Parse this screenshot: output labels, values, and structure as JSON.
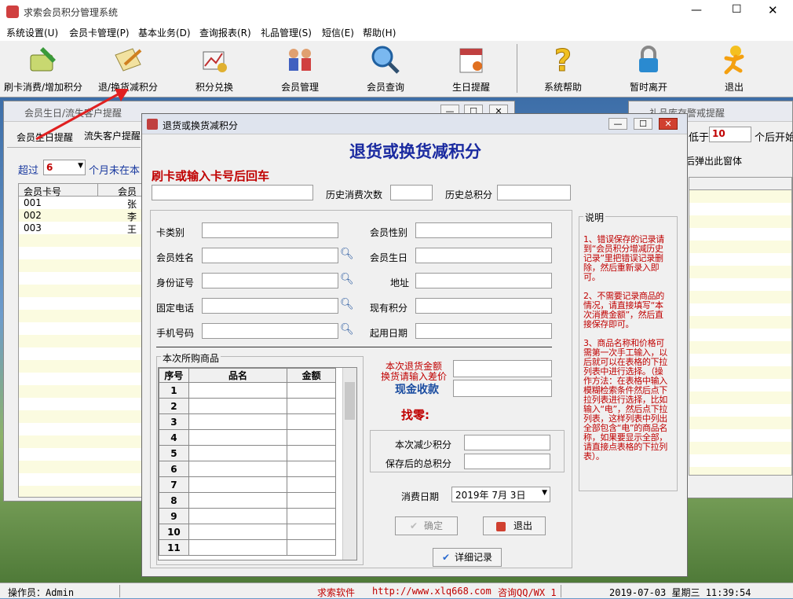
{
  "app": {
    "title": "求索会员积分管理系统",
    "window_controls": [
      "—",
      "☐",
      "✕"
    ]
  },
  "menu": [
    "系统设置(U)",
    "会员卡管理(P)",
    "基本业务(D)",
    "查询报表(R)",
    "礼品管理(S)",
    "短信(E)",
    "帮助(H)"
  ],
  "toolbar": [
    "刷卡消费/增加积分",
    "退/换货减积分",
    "积分兑换",
    "会员管理",
    "会员查询",
    "生日提醒",
    "系统帮助",
    "暂时离开",
    "退出"
  ],
  "birthday_win": {
    "title": "会员生日/流失客户提醒",
    "tabs": [
      "会员生日提醒",
      "流失客户提醒"
    ],
    "over_label": "超过",
    "months_value": "6",
    "months_text": "个月未在本",
    "columns": [
      "会员卡号",
      "会员姓"
    ],
    "rows": [
      {
        "card": "001",
        "name": "张三"
      },
      {
        "card": "002",
        "name": "李四"
      },
      {
        "card": "003",
        "name": "王五"
      }
    ]
  },
  "gift_win": {
    "title": "礼品库存警戒提醒",
    "below_text": "低于",
    "qty_value": "10",
    "start_text": "个后开始",
    "popup_text": "后弹出此窗体"
  },
  "main_win": {
    "title": "退货或换货减积分",
    "heading": "退货或换货减积分",
    "swipe_label": "刷卡或输入卡号后回车",
    "hist_count_label": "历史消费次数",
    "hist_total_label": "历史总积分",
    "labels": {
      "card_type": "卡类别",
      "gender": "会员性别",
      "name": "会员姓名",
      "birthday": "会员生日",
      "id": "身份证号",
      "address": "地址",
      "phone": "固定电话",
      "points": "现有积分",
      "mobile": "手机号码",
      "start": "起用日期"
    },
    "goods_group": "本次所购商品",
    "goods_cols": [
      "序号",
      "品名",
      "金额"
    ],
    "goods_rows": [
      "1",
      "2",
      "3",
      "4",
      "5",
      "6",
      "7",
      "8",
      "9",
      "10",
      "11"
    ],
    "refund_label_1": "本次退货金额",
    "refund_label_2": "换货请输入差价",
    "cash_label": "现金收款",
    "change_label": "找零:",
    "reduce_label": "本次减少积分",
    "after_label": "保存后的总积分",
    "date_label": "消费日期",
    "date_value": "2019年 7月 3日",
    "buttons": {
      "confirm": "确定",
      "exit": "退出",
      "detail": "详细记录"
    },
    "notes_title": "说明",
    "notes": [
      "1、错误保存的记录请到“会员积分增减历史记录”里把错误记录删除，然后重新录入即可。",
      "2、不需要记录商品的情况，请直接填写“本次消费金额”，然后直接保存即可。",
      "3、商品名称和价格可需第一次手工输入，以后就可以在表格的下拉列表中进行选择。（操作方法：在表格中输入模糊检索条件然后点下拉列表进行选择，比如输入“电”，然后点下拉列表，这样列表中列出全部包含“电”的商品名称，如果要显示全部，请直接点表格的下拉列表）。"
    ]
  },
  "status": {
    "operator": "操作员：Admin",
    "brand": "求索软件",
    "url": "http://www.xlq668.com",
    "contact": "咨询QQ/WX 1",
    "datetime": "2019-07-03 星期三 11:39:54"
  },
  "colors": {
    "title_red": "#c00000",
    "heading_blue": "#1a2aa0",
    "cash_blue": "#1a4ca0"
  }
}
